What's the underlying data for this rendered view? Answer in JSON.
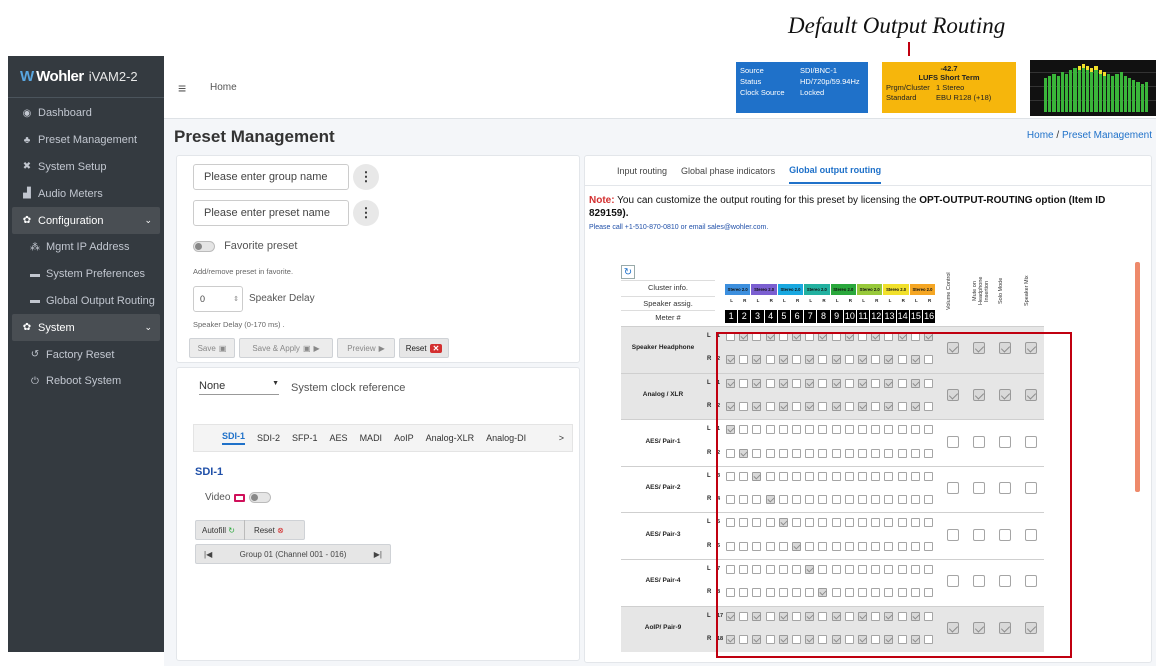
{
  "annotation": {
    "title": "Default Output Routing"
  },
  "brand": {
    "logo": "Wohler",
    "app": "iVAM2-2"
  },
  "sidebar": {
    "items": [
      {
        "label": "Dashboard",
        "icon": "dashboard-icon"
      },
      {
        "label": "Preset Management",
        "icon": "users-icon"
      },
      {
        "label": "System Setup",
        "icon": "tools-icon"
      },
      {
        "label": "Audio Meters",
        "icon": "chart-icon"
      },
      {
        "label": "Configuration",
        "icon": "gear-icon"
      },
      {
        "label": "Mgmt IP Address",
        "icon": "network-icon"
      },
      {
        "label": "System Preferences",
        "icon": "keyboard-icon"
      },
      {
        "label": "Global Output Routing",
        "icon": "keyboard-icon"
      },
      {
        "label": "System",
        "icon": "gears-icon"
      },
      {
        "label": "Factory Reset",
        "icon": "undo-icon"
      },
      {
        "label": "Reboot System",
        "icon": "power-icon"
      }
    ]
  },
  "header": {
    "home": "Home"
  },
  "source_box": {
    "rows": [
      [
        "Source",
        "SDI/BNC-1"
      ],
      [
        "Status",
        "HD/720p/59.94Hz"
      ],
      [
        "Clock Source",
        "Locked"
      ]
    ]
  },
  "lufs_box": {
    "value": "-42.7",
    "label": "LUFS  Short Term",
    "rows": [
      [
        "Prgm/Cluster",
        "1  Stereo"
      ],
      [
        "Standard",
        "EBU R128 (+18)"
      ]
    ]
  },
  "page": {
    "title": "Preset Management",
    "crumb_home": "Home",
    "crumb_sep": " / ",
    "crumb_current": "Preset Management"
  },
  "left_card": {
    "group_placeholder": "Please enter group name",
    "preset_placeholder": "Please enter preset name",
    "favorite": "Favorite preset",
    "fav_hint": "Add/remove preset in favorite.",
    "delay_value": "0",
    "delay_label": "Speaker Delay",
    "delay_hint": "Speaker Delay (0-170 ms) .",
    "buttons": {
      "save": "Save",
      "save_apply": "Save & Apply",
      "preview": "Preview",
      "reset": "Reset"
    }
  },
  "lower_card": {
    "clock_value": "None",
    "clock_label": "System clock reference",
    "tabs": [
      "SDI-1",
      "SDI-2",
      "SFP-1",
      "AES",
      "MADI",
      "AoIP",
      "Analog-XLR",
      "Analog-DI"
    ],
    "more": ">",
    "section": "SDI-1",
    "video": "Video",
    "autofill": "Autofill",
    "reset": "Reset",
    "group_nav": "Group 01 (Channel 001 - 016)"
  },
  "right_card": {
    "tabs": [
      "Input routing",
      "Global phase indicators",
      "Global output routing"
    ],
    "note_label": "Note:",
    "note_text": " You can customize the output routing for this preset by licensing the ",
    "note_bold": "OPT-OUTPUT-ROUTING option (Item ID 829159)",
    "note_end": ".",
    "contact": "Please call +1-510-870-0810 or email sales@wohler.com.",
    "grid": {
      "hdr_cluster": "Cluster info.",
      "hdr_speaker": "Speaker assig.",
      "hdr_meter": "Meter #",
      "stereo_label": "Stereo 2.0",
      "lr": [
        "L",
        "R",
        "L",
        "R",
        "L",
        "R",
        "L",
        "R",
        "L",
        "R",
        "L",
        "R",
        "L",
        "R",
        "L",
        "R"
      ],
      "meters": [
        "1",
        "2",
        "3",
        "4",
        "5",
        "6",
        "7",
        "8",
        "9",
        "10",
        "11",
        "12",
        "13",
        "14",
        "15",
        "16"
      ],
      "stereo_colors": [
        "#3c8fde",
        "#7b5fd1",
        "#19a8e0",
        "#22b1a0",
        "#2aa83c",
        "#97c93a",
        "#f1e02b",
        "#f5a623",
        "#ef5f65"
      ],
      "extra_cols": [
        "Volume Control",
        "Mute on Headphone Insertion",
        "Solo Mode",
        "Speaker Mix"
      ],
      "groups": [
        {
          "label": "Speaker Headphone",
          "rows": [
            [
              "L",
              "1"
            ],
            [
              "R",
              "2"
            ]
          ],
          "shaded": true,
          "extra_on": true
        },
        {
          "label": "Analog / XLR",
          "rows": [
            [
              "L",
              "1"
            ],
            [
              "R",
              "2"
            ]
          ],
          "shaded": true,
          "extra_on": true
        },
        {
          "label": "AES/ Pair-1",
          "rows": [
            [
              "L",
              "1"
            ],
            [
              "R",
              "2"
            ]
          ],
          "shaded": false,
          "extra_on": false
        },
        {
          "label": "AES/ Pair-2",
          "rows": [
            [
              "L",
              "3"
            ],
            [
              "R",
              "4"
            ]
          ],
          "shaded": false,
          "extra_on": false
        },
        {
          "label": "AES/ Pair-3",
          "rows": [
            [
              "L",
              "5"
            ],
            [
              "R",
              "6"
            ]
          ],
          "shaded": false,
          "extra_on": false
        },
        {
          "label": "AES/ Pair-4",
          "rows": [
            [
              "L",
              "7"
            ],
            [
              "R",
              "8"
            ]
          ],
          "shaded": false,
          "extra_on": false
        },
        {
          "label": "AoIP/ Pair-9",
          "rows": [
            [
              "L",
              "17"
            ],
            [
              "R",
              "18"
            ]
          ],
          "shaded": true,
          "extra_on": true
        }
      ],
      "checked": [
        [
          [
            1,
            3,
            5,
            7,
            9,
            11,
            13,
            15
          ],
          [
            0,
            2,
            4,
            6,
            8,
            10,
            12,
            14
          ]
        ],
        [
          [
            0,
            2,
            4,
            6,
            8,
            10,
            12,
            14
          ],
          [
            0,
            2,
            4,
            6,
            8,
            10,
            12,
            14
          ]
        ],
        [
          [
            0
          ],
          [
            1
          ]
        ],
        [
          [
            2
          ],
          [
            3
          ]
        ],
        [
          [
            4
          ],
          [
            5
          ]
        ],
        [
          [
            6
          ],
          [
            7
          ]
        ],
        [
          [
            0,
            2,
            4,
            6,
            8,
            10,
            12,
            14
          ],
          [
            0,
            2,
            4,
            6,
            8,
            10,
            12,
            14
          ]
        ]
      ]
    }
  }
}
